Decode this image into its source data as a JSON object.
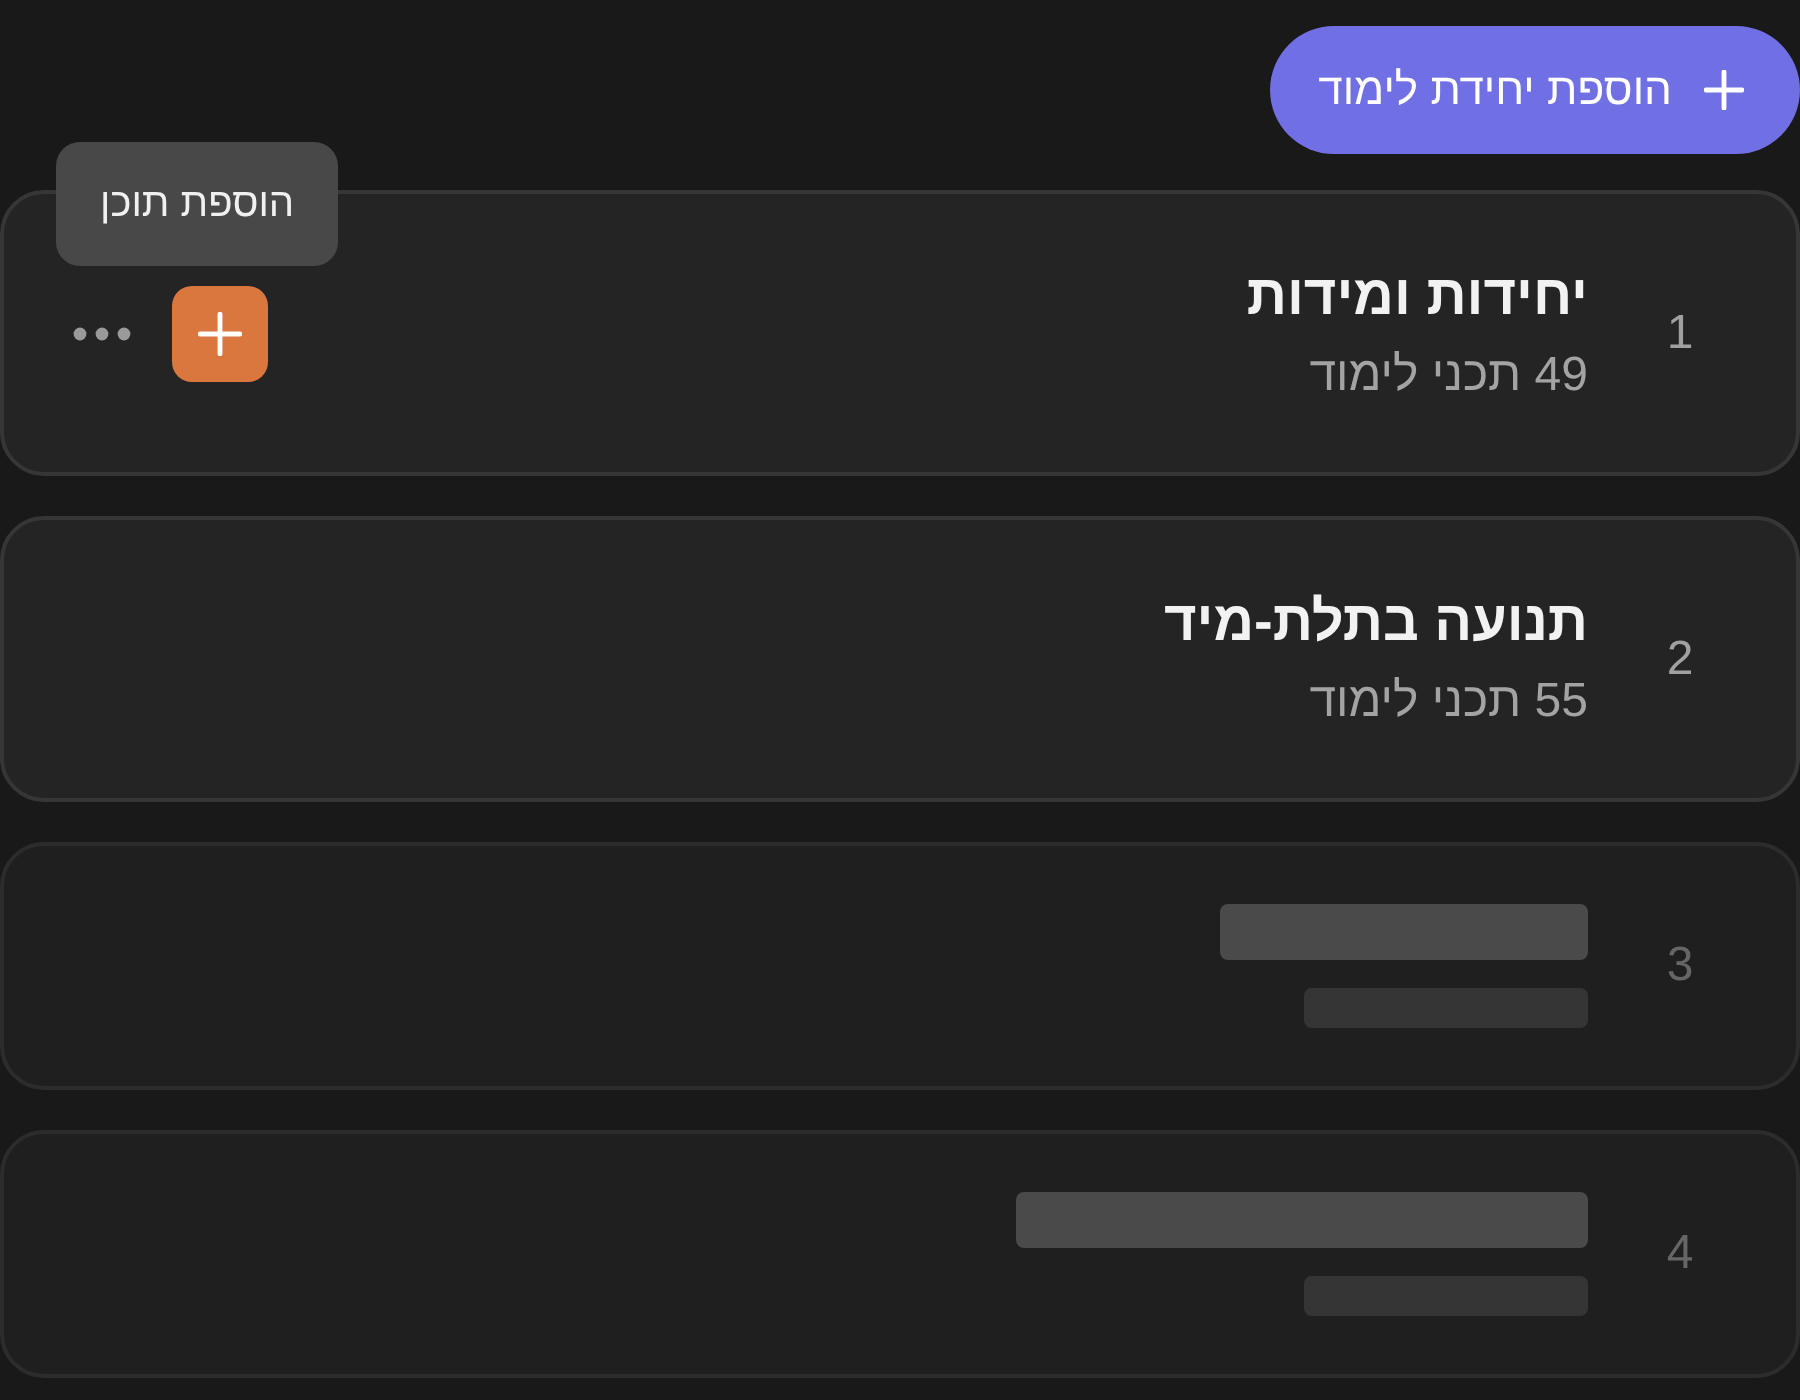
{
  "add_unit_button": {
    "label": "הוספת יחידת לימוד"
  },
  "units": [
    {
      "kind": "loaded",
      "number": "1",
      "title": "יחידות ומידות",
      "subtitle": "49 תכני לימוד",
      "hovered": true,
      "tooltip": "הוספת תוכן"
    },
    {
      "kind": "loaded",
      "number": "2",
      "title": "תנועה בתלת-מיד",
      "subtitle": "55 תכני לימוד",
      "hovered": false
    },
    {
      "kind": "skeleton",
      "number": "3"
    },
    {
      "kind": "skeleton",
      "number": "4"
    }
  ]
}
